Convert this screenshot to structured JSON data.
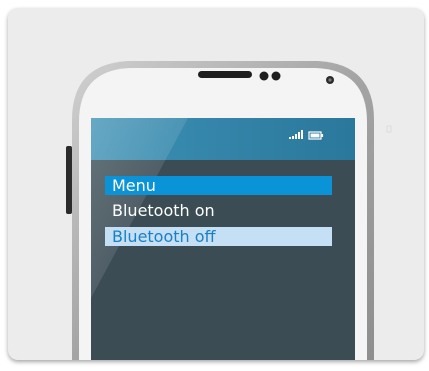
{
  "colors": {
    "card_bg": "#ececec",
    "screen_bg": "#3b4c55",
    "status_bar": "#2d7fa3",
    "menu_header_bg": "#0a93d6",
    "selected_item_bg": "#c5e0f5",
    "selected_item_text": "#1b7fc4",
    "phone_frame": "#a7a7a7"
  },
  "status_bar": {
    "icons": [
      "signal-icon",
      "battery-icon"
    ]
  },
  "menu": {
    "header": "Menu",
    "items": [
      {
        "label": "Bluetooth on",
        "selected": false
      },
      {
        "label": "Bluetooth off",
        "selected": true
      }
    ]
  }
}
